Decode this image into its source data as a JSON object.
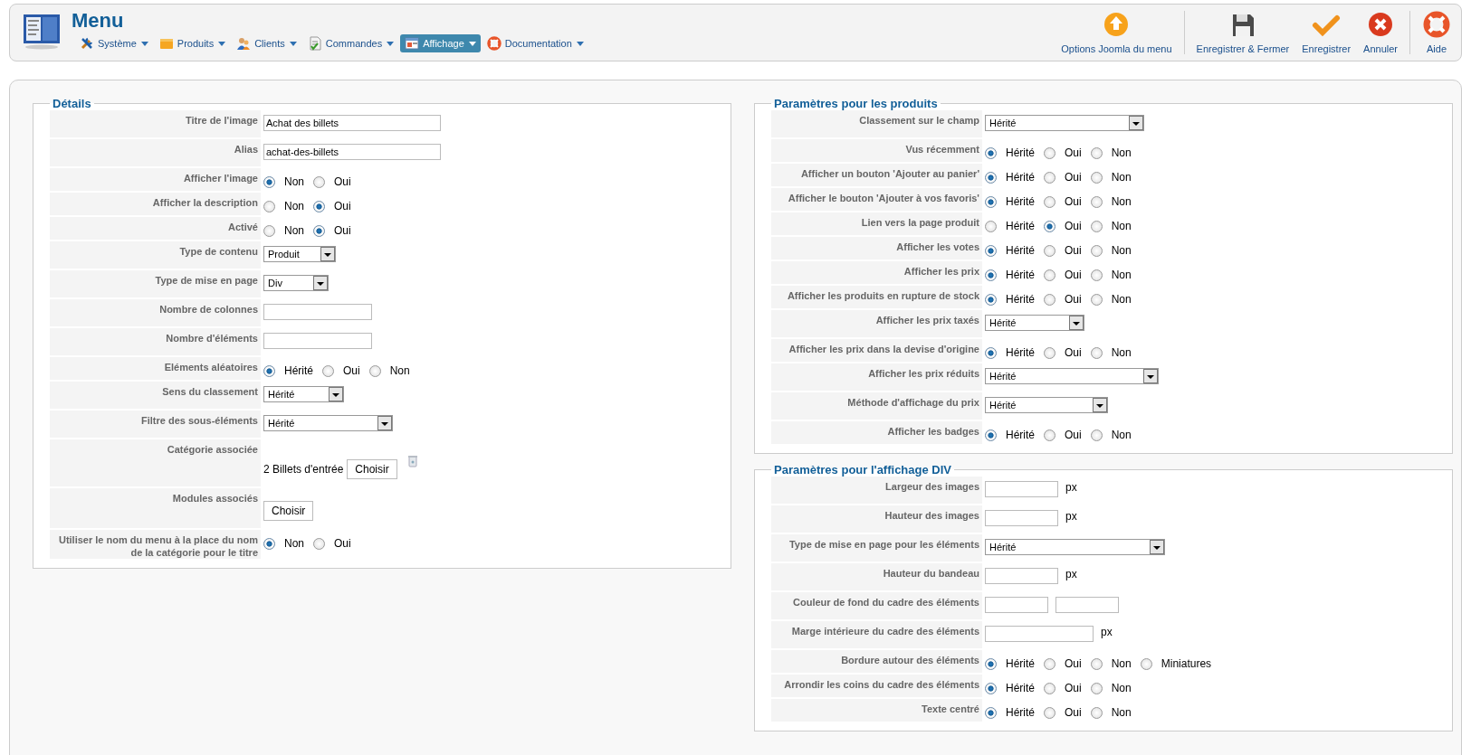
{
  "header": {
    "title": "Menu",
    "nav": [
      {
        "label": "Système",
        "selected": false
      },
      {
        "label": "Produits",
        "selected": false
      },
      {
        "label": "Clients",
        "selected": false
      },
      {
        "label": "Commandes",
        "selected": false
      },
      {
        "label": "Affichage",
        "selected": true
      },
      {
        "label": "Documentation",
        "selected": false
      }
    ],
    "toolbar": [
      {
        "buttons": [
          "Options Joomla du menu"
        ]
      },
      {
        "buttons": [
          "Enregistrer & Fermer",
          "Enregistrer",
          "Annuler"
        ]
      },
      {
        "buttons": [
          "Aide"
        ]
      }
    ]
  },
  "columns": [
    {
      "fieldsets": [
        {
          "legend": "Détails",
          "rows": [
            {
              "label": "Titre de l'image",
              "kind": "text",
              "value": "Achat des billets"
            },
            {
              "label": "Alias",
              "kind": "text",
              "value": "achat-des-billets"
            },
            {
              "label": "Afficher l'image",
              "kind": "radio",
              "options": [
                {
                  "label": "Non",
                  "selected": true
                },
                {
                  "label": "Oui",
                  "selected": false
                }
              ]
            },
            {
              "label": "Afficher la description",
              "kind": "radio",
              "options": [
                {
                  "label": "Non",
                  "selected": false
                },
                {
                  "label": "Oui",
                  "selected": true
                }
              ]
            },
            {
              "label": "Activé",
              "kind": "radio",
              "options": [
                {
                  "label": "Non",
                  "selected": false
                },
                {
                  "label": "Oui",
                  "selected": true
                }
              ]
            },
            {
              "label": "Type de contenu",
              "kind": "select",
              "value": "Produit"
            },
            {
              "label": "Type de mise en page",
              "kind": "select",
              "value": "Div"
            },
            {
              "label": "Nombre de colonnes",
              "kind": "text"
            },
            {
              "label": "Nombre d'éléments",
              "kind": "text"
            },
            {
              "label": "Eléments aléatoires",
              "kind": "radio",
              "options": [
                {
                  "label": "Hérité",
                  "selected": true
                },
                {
                  "label": "Oui",
                  "selected": false
                },
                {
                  "label": "Non",
                  "selected": false
                }
              ]
            },
            {
              "label": "Sens du classement",
              "kind": "select",
              "value": "Hérité"
            },
            {
              "label": "Filtre des sous-éléments",
              "kind": "select",
              "value": "Hérité"
            },
            {
              "label": "Catégorie associée",
              "kind": "category",
              "value": "2 Billets d'entrée",
              "button": "Choisir"
            },
            {
              "label": "Modules associés",
              "kind": "button",
              "button": "Choisir"
            },
            {
              "label": "Utiliser le nom du menu à la place du nom de la catégorie pour le titre",
              "kind": "radio",
              "options": [
                {
                  "label": "Non",
                  "selected": true
                },
                {
                  "label": "Oui",
                  "selected": false
                }
              ]
            }
          ]
        }
      ]
    },
    {
      "fieldsets": [
        {
          "legend": "Paramètres pour les produits",
          "rows": [
            {
              "label": "Classement sur le champ",
              "kind": "select",
              "value": "Hérité"
            },
            {
              "label": "Vus récemment",
              "kind": "radio",
              "options": [
                {
                  "label": "Hérité",
                  "selected": true
                },
                {
                  "label": "Oui",
                  "selected": false
                },
                {
                  "label": "Non",
                  "selected": false
                }
              ]
            },
            {
              "label": "Afficher un bouton 'Ajouter au panier'",
              "kind": "radio",
              "options": [
                {
                  "label": "Hérité",
                  "selected": true
                },
                {
                  "label": "Oui",
                  "selected": false
                },
                {
                  "label": "Non",
                  "selected": false
                }
              ]
            },
            {
              "label": "Afficher le bouton 'Ajouter à vos favoris'",
              "kind": "radio",
              "options": [
                {
                  "label": "Hérité",
                  "selected": true
                },
                {
                  "label": "Oui",
                  "selected": false
                },
                {
                  "label": "Non",
                  "selected": false
                }
              ]
            },
            {
              "label": "Lien vers la page produit",
              "kind": "radio",
              "options": [
                {
                  "label": "Hérité",
                  "selected": false
                },
                {
                  "label": "Oui",
                  "selected": true
                },
                {
                  "label": "Non",
                  "selected": false
                }
              ]
            },
            {
              "label": "Afficher les votes",
              "kind": "radio",
              "options": [
                {
                  "label": "Hérité",
                  "selected": true
                },
                {
                  "label": "Oui",
                  "selected": false
                },
                {
                  "label": "Non",
                  "selected": false
                }
              ]
            },
            {
              "label": "Afficher les prix",
              "kind": "radio",
              "options": [
                {
                  "label": "Hérité",
                  "selected": true
                },
                {
                  "label": "Oui",
                  "selected": false
                },
                {
                  "label": "Non",
                  "selected": false
                }
              ]
            },
            {
              "label": "Afficher les produits en rupture de stock",
              "kind": "radio",
              "options": [
                {
                  "label": "Hérité",
                  "selected": true
                },
                {
                  "label": "Oui",
                  "selected": false
                },
                {
                  "label": "Non",
                  "selected": false
                }
              ]
            },
            {
              "label": "Afficher les prix taxés",
              "kind": "select",
              "value": "Hérité"
            },
            {
              "label": "Afficher les prix dans la devise d'origine",
              "kind": "radio",
              "options": [
                {
                  "label": "Hérité",
                  "selected": true
                },
                {
                  "label": "Oui",
                  "selected": false
                },
                {
                  "label": "Non",
                  "selected": false
                }
              ]
            },
            {
              "label": "Afficher les prix réduits",
              "kind": "select",
              "value": "Hérité"
            },
            {
              "label": "Méthode d'affichage du prix",
              "kind": "select",
              "value": "Hérité"
            },
            {
              "label": "Afficher les badges",
              "kind": "radio",
              "options": [
                {
                  "label": "Hérité",
                  "selected": true
                },
                {
                  "label": "Oui",
                  "selected": false
                },
                {
                  "label": "Non",
                  "selected": false
                }
              ]
            }
          ]
        },
        {
          "legend": "Paramètres pour l'affichage DIV",
          "rows": [
            {
              "label": "Largeur des images",
              "kind": "text",
              "unit": "px"
            },
            {
              "label": "Hauteur des images",
              "kind": "text",
              "unit": "px"
            },
            {
              "label": "Type de mise en page pour les éléments",
              "kind": "select",
              "value": "Hérité"
            },
            {
              "label": "Hauteur du bandeau",
              "kind": "text",
              "unit": "px"
            },
            {
              "label": "Couleur de fond du cadre des éléments",
              "kind": "pair"
            },
            {
              "label": "Marge intérieure du cadre des éléments",
              "kind": "text",
              "unit": "px"
            },
            {
              "label": "Bordure autour des éléments",
              "kind": "radio",
              "options": [
                {
                  "label": "Hérité",
                  "selected": true
                },
                {
                  "label": "Oui",
                  "selected": false
                },
                {
                  "label": "Non",
                  "selected": false
                },
                {
                  "label": "Miniatures",
                  "selected": false
                }
              ]
            },
            {
              "label": "Arrondir les coins du cadre des éléments",
              "kind": "radio",
              "options": [
                {
                  "label": "Hérité",
                  "selected": true
                },
                {
                  "label": "Oui",
                  "selected": false
                },
                {
                  "label": "Non",
                  "selected": false
                }
              ]
            },
            {
              "label": "Texte centré",
              "kind": "radio",
              "options": [
                {
                  "label": "Hérité",
                  "selected": true
                },
                {
                  "label": "Oui",
                  "selected": false
                },
                {
                  "label": "Non",
                  "selected": false
                }
              ]
            }
          ]
        }
      ]
    }
  ]
}
